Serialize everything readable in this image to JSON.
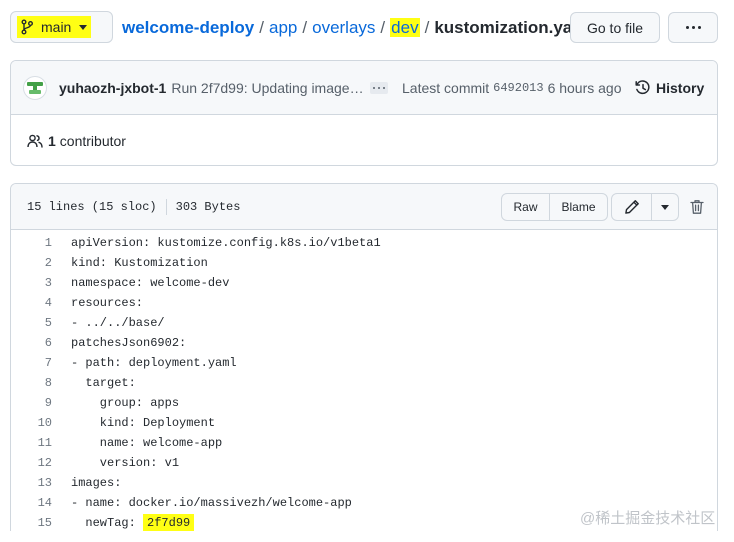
{
  "topbar": {
    "branch": "main",
    "breadcrumb": {
      "repo": "welcome-deploy",
      "path": [
        "app",
        "overlays",
        "dev"
      ],
      "separator": "/",
      "file": "kustomization.yaml"
    },
    "goto_file": "Go to file",
    "more_icon": "kebab-horizontal-icon"
  },
  "commit": {
    "author": "yuhaozh-jxbot-1",
    "message": "Run 2f7d99: Updating image…",
    "latest_label": "Latest commit",
    "sha": "6492013",
    "time": "6 hours ago",
    "history_label": "History"
  },
  "contributors": {
    "count": "1",
    "label": "contributor"
  },
  "file": {
    "lines_info": "15 lines (15 sloc)",
    "size": "303 Bytes",
    "raw_label": "Raw",
    "blame_label": "Blame",
    "code": [
      "apiVersion: kustomize.config.k8s.io/v1beta1",
      "kind: Kustomization",
      "namespace: welcome-dev",
      "resources:",
      "- ../../base/",
      "patchesJson6902:",
      "- path: deployment.yaml",
      "  target:",
      "    group: apps",
      "    kind: Deployment",
      "    name: welcome-app",
      "    version: v1",
      "images:",
      "- name: docker.io/massivezh/welcome-app",
      "  newTag: 2f7d99"
    ],
    "highlight": {
      "line": 15,
      "text": "2f7d99"
    }
  },
  "watermark": "@稀土掘金技术社区",
  "colors": {
    "link": "#0969da",
    "highlight": "#ffff14",
    "border": "#d0d7de",
    "header_bg": "#f6f8fa"
  }
}
